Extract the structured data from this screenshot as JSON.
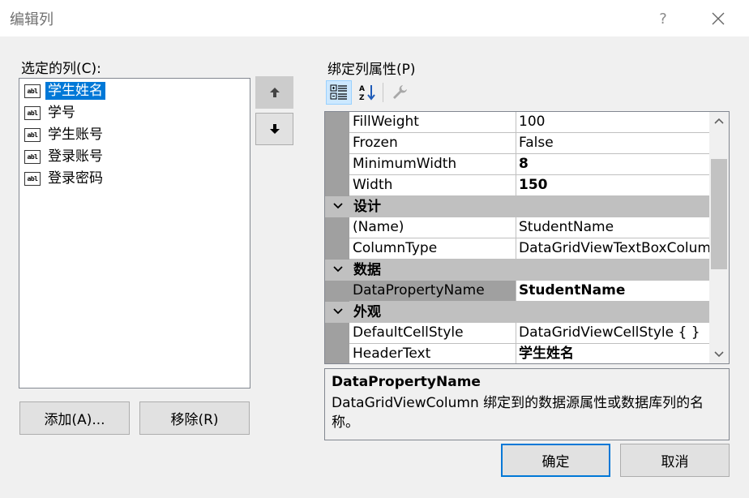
{
  "window": {
    "title": "编辑列",
    "help_label": "?"
  },
  "left": {
    "selected_columns_label": "选定的列(C):",
    "columns": [
      {
        "label": "学生姓名",
        "selected": true,
        "icon": "textbox-icon"
      },
      {
        "label": "学号",
        "selected": false,
        "icon": "textbox-icon"
      },
      {
        "label": "学生账号",
        "selected": false,
        "icon": "textbox-icon"
      },
      {
        "label": "登录账号",
        "selected": false,
        "icon": "textbox-icon"
      },
      {
        "label": "登录密码",
        "selected": false,
        "icon": "textbox-icon"
      }
    ],
    "add_button": "添加(A)...",
    "remove_button": "移除(R)"
  },
  "right": {
    "bound_properties_label": "绑定列属性(P)",
    "toolbar": {
      "categorized_icon": "categorized-icon",
      "alphabetical_icon": "alphabetical-sort-icon",
      "property_pages_icon": "wrench-icon"
    },
    "grid": {
      "rows_top": [
        {
          "name": "FillWeight",
          "value": "100",
          "bold": false
        },
        {
          "name": "Frozen",
          "value": "False",
          "bold": false
        },
        {
          "name": "MinimumWidth",
          "value": "8",
          "bold": true
        },
        {
          "name": "Width",
          "value": "150",
          "bold": true
        }
      ],
      "category_design": "设计",
      "rows_design": [
        {
          "name": "(Name)",
          "value": "StudentName",
          "bold": false
        },
        {
          "name": "ColumnType",
          "value": "DataGridViewTextBoxColumn",
          "bold": false
        }
      ],
      "category_data": "数据",
      "rows_data": [
        {
          "name": "DataPropertyName",
          "value": "StudentName",
          "bold": true,
          "selected": true
        }
      ],
      "category_appearance": "外观",
      "rows_appearance": [
        {
          "name": "DefaultCellStyle",
          "value": "DataGridViewCellStyle { }",
          "bold": false
        },
        {
          "name": "HeaderText",
          "value": "学生姓名",
          "bold": true
        }
      ]
    },
    "description": {
      "title": "DataPropertyName",
      "text": "DataGridViewColumn 绑定到的数据源属性或数据库列的名称。"
    }
  },
  "footer": {
    "ok_button": "确定",
    "cancel_button": "取消"
  },
  "colors": {
    "selection": "#0078d7",
    "window_bg": "#f0f0f0",
    "grid_bg": "#c0c0c0"
  }
}
